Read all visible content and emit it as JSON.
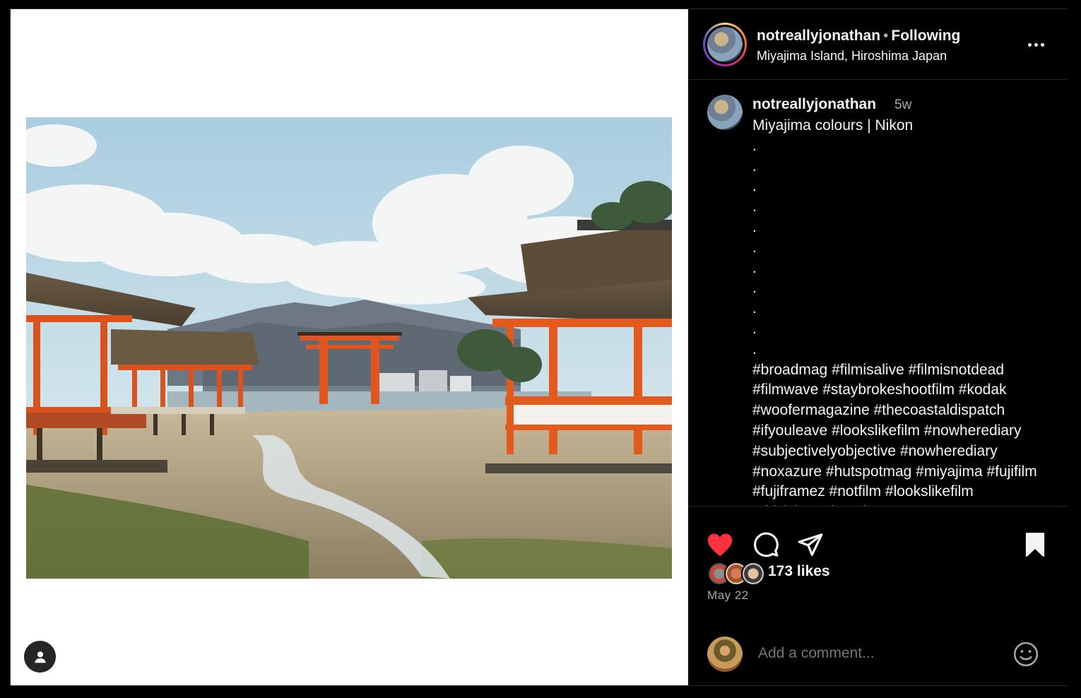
{
  "post": {
    "username": "notreallyjonathan",
    "separator": "•",
    "follow_status": "Following",
    "location": "Miyajima Island, Hiroshima Japan",
    "more_icon": "more-horizontal-icon"
  },
  "caption": {
    "username": "notreallyjonathan",
    "time_ago": "5w",
    "text": "Miyajima colours | Nikon\n.\n.\n.\n.\n.\n.\n.\n.\n.\n.\n.\n#broadmag #filmisalive #filmisnotdead #filmwave #staybrokeshootfilm #kodak #woofermagazine #thecoastaldispatch #ifyouleave #lookslikefilm #nowherediary #subjectivelyobjective #nowherediary #noxazure #hutspotmag #miyajima #fujifilm #fujiframez #notfilm #lookslikefilm #thisisjustadorpshorts"
  },
  "actions": {
    "like_icon": "heart-filled-icon",
    "comment_icon": "comment-icon",
    "share_icon": "share-icon",
    "save_icon": "bookmark-filled-icon",
    "like_color": "#ff3040"
  },
  "likes": {
    "count_text": "173 likes"
  },
  "date": "May 22",
  "comment": {
    "placeholder": "Add a comment...",
    "emoji_icon": "emoji-icon"
  },
  "media": {
    "tag_icon": "user-tag-icon"
  }
}
